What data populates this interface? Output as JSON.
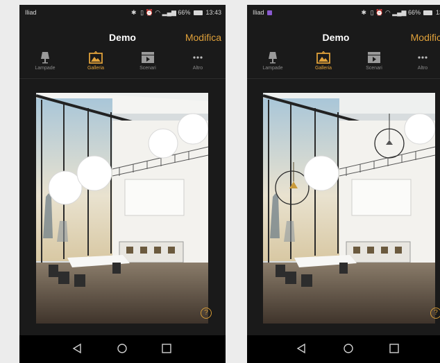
{
  "screens": [
    {
      "id": "left",
      "status": {
        "carrier": "Iliad",
        "right_text": "66%",
        "time": "13:43"
      },
      "header": {
        "title": "Demo",
        "edit_label": "Modifica"
      },
      "tabs": [
        {
          "label": "Lampade",
          "icon": "lamp-icon",
          "active": false
        },
        {
          "label": "Galleria",
          "icon": "gallery-icon",
          "active": true
        },
        {
          "label": "Scenari",
          "icon": "scene-clapper-icon",
          "active": false
        },
        {
          "label": "Altro",
          "icon": "more-dots-icon",
          "active": false
        }
      ],
      "help": "?",
      "nav": [
        "back-triangle-icon",
        "home-circle-icon",
        "recent-square-icon"
      ]
    },
    {
      "id": "right",
      "status": {
        "carrier": "Iliad",
        "right_text": "66%",
        "time": "13"
      },
      "header": {
        "title": "Demo",
        "edit_label": "Modific"
      },
      "tabs": [
        {
          "label": "Lampade",
          "icon": "lamp-icon",
          "active": false
        },
        {
          "label": "Galleria",
          "icon": "gallery-icon",
          "active": true
        },
        {
          "label": "Scenari",
          "icon": "scene-clapper-icon",
          "active": false
        },
        {
          "label": "Altro",
          "icon": "more-dots-icon",
          "active": false
        }
      ],
      "help": "?",
      "nav": [
        "back-triangle-icon",
        "home-circle-icon",
        "recent-square-icon"
      ]
    }
  ],
  "colors": {
    "accent": "#e0a13a",
    "background": "#1a1a1a",
    "page": "#ececec"
  }
}
